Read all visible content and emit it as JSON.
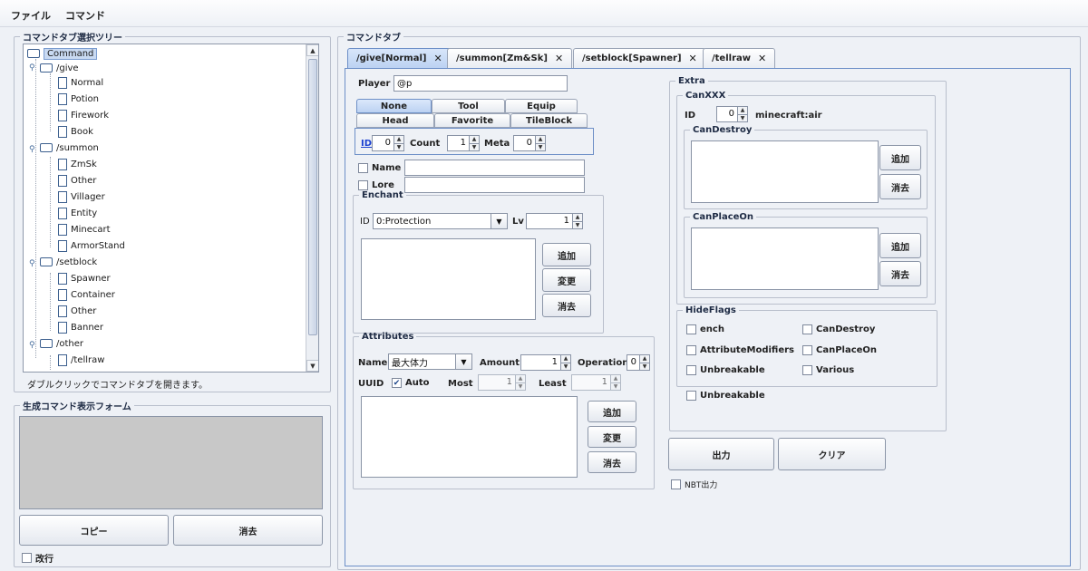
{
  "menu": {
    "file": "ファイル",
    "command": "コマンド"
  },
  "left": {
    "tree_title": "コマンドタブ選択ツリー",
    "tree": {
      "root": "Command",
      "give": "/give",
      "give_children": [
        "Normal",
        "Potion",
        "Firework",
        "Book"
      ],
      "summon": "/summon",
      "summon_children": [
        "ZmSk",
        "Other",
        "Villager",
        "Entity",
        "Minecart",
        "ArmorStand"
      ],
      "setblock": "/setblock",
      "setblock_children": [
        "Spawner",
        "Container",
        "Other",
        "Banner"
      ],
      "other": "/other",
      "other_children": [
        "/tellraw"
      ]
    },
    "hint": "ダブルクリックでコマンドタブを開きます。",
    "output_title": "生成コマンド表示フォーム",
    "copy_btn": "コピー",
    "clear_btn": "消去",
    "wrap_label": "改行"
  },
  "right": {
    "group_title": "コマンドタブ",
    "tabs": [
      {
        "label": "/give[Normal]"
      },
      {
        "label": "/summon[Zm&Sk]"
      },
      {
        "label": "/setblock[Spawner]"
      },
      {
        "label": "/tellraw"
      }
    ],
    "player_label": "Player",
    "player_value": "@p",
    "item_tabs_row1": [
      "None",
      "Tool",
      "Equip"
    ],
    "item_tabs_row2": [
      "Head",
      "Favorite",
      "TileBlock"
    ],
    "id_label": "ID",
    "id_value": "0",
    "count_label": "Count",
    "count_value": "1",
    "meta_label": "Meta",
    "meta_value": "0",
    "name_label": "Name",
    "lore_label": "Lore",
    "enchant": {
      "title": "Enchant",
      "id_label": "ID",
      "id_value": "0:Protection",
      "lv_label": "Lv",
      "lv_value": "1",
      "add": "追加",
      "edit": "変更",
      "del": "消去"
    },
    "attributes": {
      "title": "Attributes",
      "name_label": "Name",
      "name_value": "最大体力",
      "amount_label": "Amount",
      "amount_value": "1",
      "operation_label": "Operation",
      "operation_value": "0",
      "uuid_label": "UUID",
      "auto_label": "Auto",
      "most_label": "Most",
      "most_value": "1",
      "least_label": "Least",
      "least_value": "1",
      "add": "追加",
      "edit": "変更",
      "del": "消去"
    },
    "extra": {
      "title": "Extra",
      "canxxx_title": "CanXXX",
      "id_label": "ID",
      "id_value": "0",
      "id_name": "minecraft:air",
      "candestroy_title": "CanDestroy",
      "canplaceon_title": "CanPlaceOn",
      "add": "追加",
      "del": "消去",
      "hideflags_title": "HideFlags",
      "flags": [
        "ench",
        "CanDestroy",
        "AttributeModifiers",
        "CanPlaceOn",
        "Unbreakable",
        "Various"
      ],
      "unbreakable": "Unbreakable"
    },
    "output_btn": "出力",
    "clear_btn": "クリア",
    "nbt_label": "NBT出力"
  }
}
